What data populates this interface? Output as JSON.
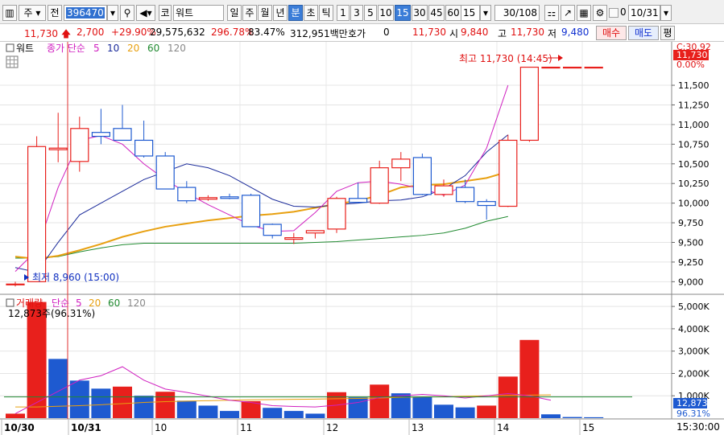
{
  "toolbar": {
    "type_label": "주",
    "scope_label": "전",
    "code": "396470",
    "market_label": "코",
    "stock_name": "워트",
    "periods": [
      "일",
      "주",
      "월",
      "년",
      "분",
      "초",
      "틱"
    ],
    "period_selected": "분",
    "intervals": [
      "1",
      "3",
      "5",
      "10",
      "15",
      "30",
      "45",
      "60"
    ],
    "interval_selected": "15",
    "interval_value": "15",
    "page_info": "30/108",
    "check_label": "0",
    "date_value": "10/31"
  },
  "quote": {
    "price": "11,730",
    "change": "2,700",
    "change_pct": "+29.90%",
    "volume": "29,575,632",
    "vol_ratio": "296.78%",
    "turnover": "83.47%",
    "amount": "312,951백만",
    "hoga_label": "호가",
    "hoga_value": "0",
    "ask_price": "11,730",
    "open_label": "시",
    "open": "9,840",
    "high_label": "고",
    "high": "11,730",
    "low_label": "저",
    "low": "9,480",
    "buy_label": "매수",
    "sell_label": "매도",
    "eval_label": "평"
  },
  "price_legend": {
    "name": "워트",
    "indicator": "종가 단순",
    "ma": [
      {
        "period": "5",
        "color": "#d020c0"
      },
      {
        "period": "10",
        "color": "#1a2a9a"
      },
      {
        "period": "20",
        "color": "#e8a010"
      },
      {
        "period": "60",
        "color": "#208a30"
      },
      {
        "period": "120",
        "color": "#888888"
      }
    ]
  },
  "price_axis": {
    "ticks": [
      "11,500",
      "11,250",
      "11,000",
      "10,750",
      "10,500",
      "10,250",
      "10,000",
      "9,750",
      "9,500",
      "9,250",
      "9,000"
    ],
    "top_label": "C:30.92",
    "current_price": "11,730",
    "pct_label": "0.00%"
  },
  "annotations": {
    "high": "최고 11,730 (14:45)",
    "low": "최저 8,960 (15:00)"
  },
  "volume_legend": {
    "name": "거래량",
    "indicator": "단순",
    "ma": [
      "5",
      "20",
      "60",
      "120"
    ],
    "info": "12,873주(96.31%)"
  },
  "volume_axis": {
    "ticks": [
      "5,000K",
      "4,000K",
      "3,000K",
      "2,000K",
      "1,000K"
    ],
    "current": "12,873",
    "pct": "96.31%"
  },
  "time_axis": {
    "labels": [
      "10/30",
      "10/31",
      "10",
      "11",
      "12",
      "13",
      "14",
      "15"
    ],
    "clock": "15:30:00"
  },
  "colors": {
    "up": "#e8201c",
    "down": "#1e5ad0",
    "ma5": "#d020c0",
    "ma10": "#1a2a9a",
    "ma20": "#e8a010",
    "ma60": "#208a30"
  },
  "chart_data": {
    "type": "candlestick",
    "ylim": [
      8850,
      11920
    ],
    "candles": [
      {
        "o": 8960,
        "h": 9000,
        "l": 8940,
        "c": 8970
      },
      {
        "o": 9000,
        "h": 10850,
        "l": 9440,
        "c": 10720
      },
      {
        "o": 10680,
        "h": 11150,
        "l": 10520,
        "c": 10700
      },
      {
        "o": 10530,
        "h": 11100,
        "l": 10400,
        "c": 10950
      },
      {
        "o": 10900,
        "h": 11200,
        "l": 10750,
        "c": 10850
      },
      {
        "o": 10950,
        "h": 11250,
        "l": 10830,
        "c": 10800
      },
      {
        "o": 10800,
        "h": 11050,
        "l": 10580,
        "c": 10600
      },
      {
        "o": 10600,
        "h": 10650,
        "l": 10200,
        "c": 10180
      },
      {
        "o": 10200,
        "h": 10280,
        "l": 10000,
        "c": 10030
      },
      {
        "o": 10050,
        "h": 10100,
        "l": 10030,
        "c": 10070
      },
      {
        "o": 10080,
        "h": 10120,
        "l": 10050,
        "c": 10060
      },
      {
        "o": 10100,
        "h": 10120,
        "l": 9730,
        "c": 9700
      },
      {
        "o": 9730,
        "h": 9740,
        "l": 9550,
        "c": 9590
      },
      {
        "o": 9540,
        "h": 9620,
        "l": 9480,
        "c": 9560
      },
      {
        "o": 9620,
        "h": 9640,
        "l": 9550,
        "c": 9650
      },
      {
        "o": 9670,
        "h": 10080,
        "l": 9620,
        "c": 10060
      },
      {
        "o": 10060,
        "h": 10260,
        "l": 10000,
        "c": 10010
      },
      {
        "o": 10000,
        "h": 10540,
        "l": 9990,
        "c": 10450
      },
      {
        "o": 10450,
        "h": 10650,
        "l": 10280,
        "c": 10560
      },
      {
        "o": 10580,
        "h": 10630,
        "l": 10100,
        "c": 10110
      },
      {
        "o": 10110,
        "h": 10300,
        "l": 10080,
        "c": 10220
      },
      {
        "o": 10200,
        "h": 10300,
        "l": 10000,
        "c": 10020
      },
      {
        "o": 10020,
        "h": 10050,
        "l": 9790,
        "c": 9970
      },
      {
        "o": 9960,
        "h": 10870,
        "l": 9950,
        "c": 10800
      },
      {
        "o": 10800,
        "h": 11730,
        "l": 10780,
        "c": 11730
      },
      {
        "o": 11730,
        "h": 11730,
        "l": 11730,
        "c": 11730
      },
      {
        "o": 11730,
        "h": 11730,
        "l": 11730,
        "c": 11730
      },
      {
        "o": 11730,
        "h": 11730,
        "l": 11730,
        "c": 11730
      }
    ],
    "volume": [
      200,
      5200,
      2650,
      1680,
      1320,
      1410,
      1000,
      1180,
      780,
      560,
      320,
      760,
      460,
      320,
      200,
      1160,
      930,
      1500,
      1110,
      940,
      600,
      480,
      560,
      1860,
      3500,
      170,
      50,
      40
    ],
    "volume_up": [
      true,
      true,
      false,
      false,
      false,
      true,
      false,
      true,
      false,
      false,
      false,
      true,
      false,
      false,
      false,
      true,
      false,
      true,
      false,
      false,
      false,
      false,
      true,
      true,
      true,
      false,
      false,
      false
    ],
    "ma5": [
      9130,
      9400,
      10200,
      10800,
      10860,
      10750,
      10500,
      10300,
      10130,
      9980,
      9850,
      9720,
      9640,
      9650,
      9880,
      10150,
      10260,
      10280,
      10240,
      10180,
      10100,
      10230,
      10700,
      11500
    ],
    "ma10": [
      9180,
      9120,
      9500,
      9850,
      10000,
      10150,
      10300,
      10400,
      10500,
      10450,
      10350,
      10200,
      10050,
      9960,
      9950,
      9980,
      10000,
      10030,
      10040,
      10080,
      10180,
      10350,
      10650,
      10870
    ],
    "ma20": [
      9320,
      9290,
      9330,
      9400,
      9480,
      9570,
      9640,
      9700,
      9740,
      9780,
      9810,
      9840,
      9860,
      9890,
      9940,
      9990,
      10030,
      10100,
      10200,
      10230,
      10240,
      10280,
      10320,
      10400
    ],
    "ma60": [
      9300,
      9300,
      9320,
      9380,
      9430,
      9470,
      9490,
      9490,
      9490,
      9490,
      9490,
      9490,
      9490,
      9490,
      9500,
      9510,
      9530,
      9550,
      9570,
      9590,
      9620,
      9680,
      9770,
      9830
    ],
    "vol_ma5": [
      200,
      700,
      1200,
      1700,
      1900,
      2300,
      1700,
      1300,
      1150,
      980,
      800,
      700,
      560,
      520,
      500,
      580,
      700,
      920,
      1000,
      1060,
      1000,
      900,
      1000,
      1100,
      1000,
      800
    ],
    "vol_ma20": [
      500,
      500,
      530,
      560,
      600,
      650,
      700,
      740,
      760,
      780,
      800,
      820,
      830,
      840,
      850,
      870,
      880,
      900,
      930,
      950,
      960,
      980,
      1000,
      1020,
      1030,
      1040
    ]
  }
}
